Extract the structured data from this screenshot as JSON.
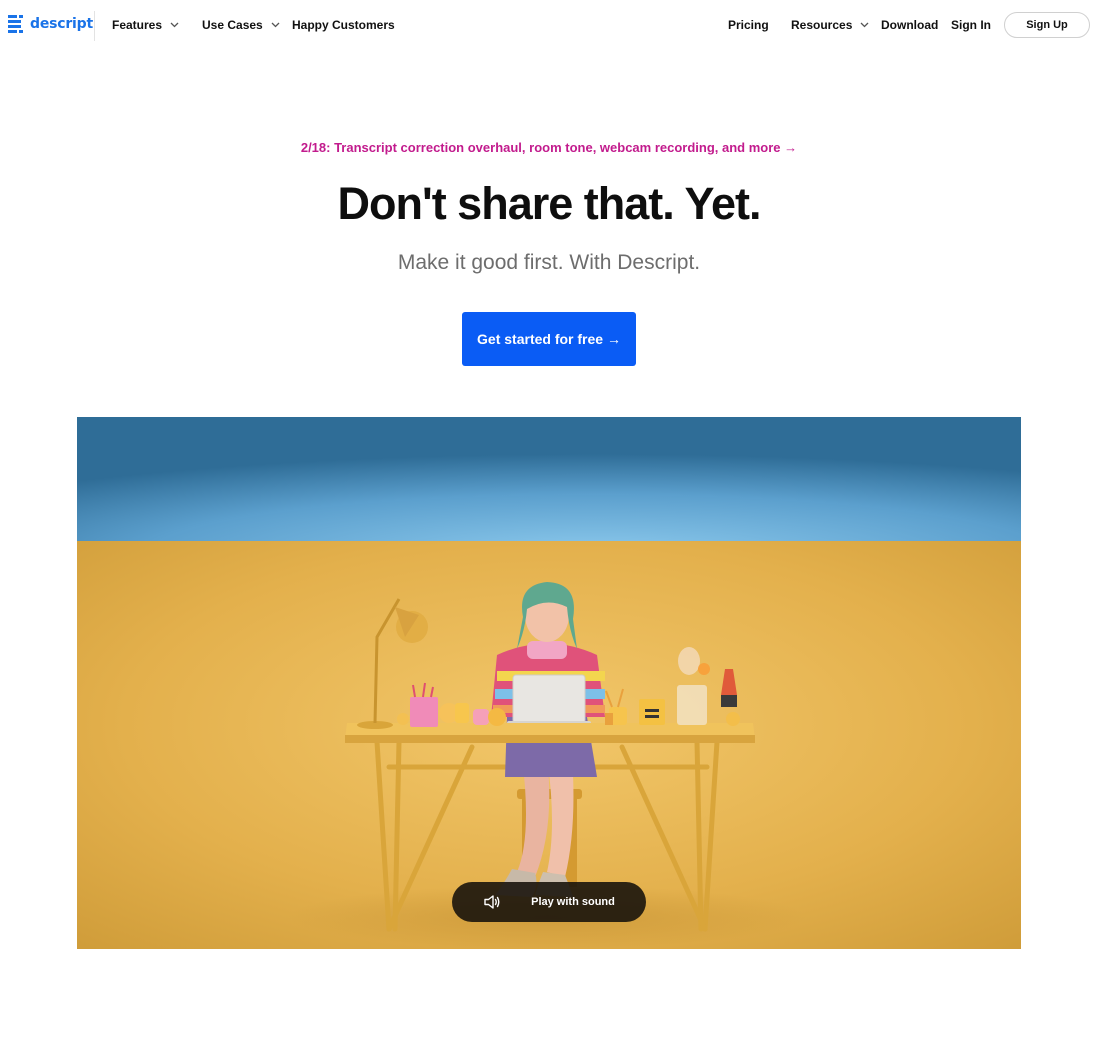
{
  "brand": {
    "name": "descript",
    "accent": "#1a73e8"
  },
  "nav": {
    "left": [
      {
        "label": "Features",
        "dropdown": true
      },
      {
        "label": "Use Cases",
        "dropdown": true
      },
      {
        "label": "Happy Customers",
        "dropdown": false
      }
    ],
    "right": [
      {
        "label": "Pricing",
        "dropdown": false
      },
      {
        "label": "Resources",
        "dropdown": true
      },
      {
        "label": "Download",
        "dropdown": false
      },
      {
        "label": "Sign In",
        "dropdown": false
      }
    ],
    "signup_label": "Sign Up"
  },
  "hero": {
    "announcement": "2/18: Transcript correction overhaul, room tone, webcam recording, and more →",
    "headline": "Don't share that. Yet.",
    "subhead": "Make it good first. With Descript.",
    "cta_label": "Get started for free →"
  },
  "colors": {
    "announcement": "#c21b8d",
    "cta": "#0a5cf5",
    "wall": "#e6b548",
    "sky": "#5fa6d2"
  },
  "video": {
    "play_label": "Play with sound",
    "play_icon": "speaker-icon"
  }
}
